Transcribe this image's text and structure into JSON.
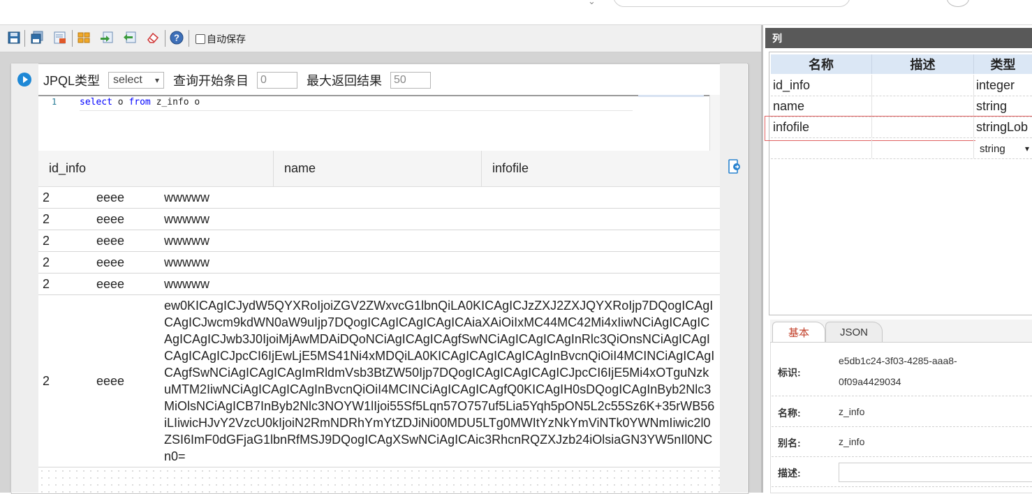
{
  "toolbar": {
    "icons": [
      "save-icon",
      "save-all-icon",
      "export-icon",
      "database-icon",
      "import-icon",
      "transfer-icon",
      "eraser-icon",
      "help-icon"
    ],
    "autosave_label": "自动保存"
  },
  "query": {
    "type_label": "JPQL类型",
    "type_value": "select",
    "start_label": "查询开始条目",
    "start_value": "0",
    "max_label": "最大返回结果",
    "max_value": "50",
    "line_number": "1",
    "code_kw1": "select",
    "code_mid": " o ",
    "code_kw2": "from",
    "code_rest": " z_info o"
  },
  "results": {
    "columns": [
      "id_info",
      "name",
      "infofile"
    ],
    "rows": [
      {
        "id": "2",
        "name": "eeee",
        "file": "wwwww"
      },
      {
        "id": "2",
        "name": "eeee",
        "file": "wwwww"
      },
      {
        "id": "2",
        "name": "eeee",
        "file": "wwwww"
      },
      {
        "id": "2",
        "name": "eeee",
        "file": "wwwww"
      },
      {
        "id": "2",
        "name": "eeee",
        "file": "wwwww"
      },
      {
        "id": "2",
        "name": "eeee",
        "file": "ew0KICAgICJydW5QYXRoIjoiZGV2ZWxvcG1lbnQiLA0KICAgICJzZXJ2ZXJQYXRoIjp7DQogICAgICAgICJwcm9kdWN0aW9uIjp7DQogICAgICAgICAgICAiaXAiOiIxMC44MC42Mi4xIiwNCiAgICAgICAgICAgICJwb3J0IjoiMjAwMDAiDQoNCiAgICAgICAgfSwNCiAgICAgICAgInRlc3QiOnsNCiAgICAgICAgICAgICJpcCI6IjEwLjE5MS41Ni4xMDQiLA0KICAgICAgICAgICAgInBvcnQiOiI4MCINCiAgICAgICAgfSwNCiAgICAgICAgImRldmVsb3BtZW50Ijp7DQogICAgICAgICAgICJpcCI6IjE5Mi4xOTguNzkuMTM2IiwNCiAgICAgICAgInBvcnQiOiI4MCINCiAgICAgICAgfQ0KICAgIH0sDQogICAgInByb2Nlc3MiOlsNCiAgICB7InByb2Nlc3NOYW1lIjoi55Sf5Lqn57O757uf5Lia5Yqh5pON5L2c55Sz6K+35rWB56iLIiwicHJvY2VzcU0kIjoiN2RmNDRhYmYtZDJiNi00MDU5LTg0MWItYzNkYmViNTk0YWNmIiwic2l0ZSI6ImF0dGFjaG1lbnRfMSJ9DQogICAgXSwNCiAgICAic3RhcnRQZXJzb24iOlsiaGN3YW5nIl0NCn0="
      }
    ]
  },
  "columns_panel": {
    "title": "列",
    "headers": [
      "名称",
      "描述",
      "类型"
    ],
    "rows": [
      {
        "name": "id_info",
        "desc": "",
        "type": "integer"
      },
      {
        "name": "name",
        "desc": "",
        "type": "string"
      },
      {
        "name": "infofile",
        "desc": "",
        "type": "stringLob"
      }
    ],
    "new_row_type": "string"
  },
  "tabs": [
    "基本",
    "JSON"
  ],
  "properties": {
    "id_label": "标识:",
    "id_value_line1": "e5db1c24-3f03-4285-aaa8-",
    "id_value_line2": "0f09a4429034",
    "name_label": "名称:",
    "name_value": "z_info",
    "alias_label": "别名:",
    "alias_value": "z_info",
    "desc_label": "描述:",
    "desc_value": ""
  },
  "colors": {
    "accent": "#1e88d6",
    "titlebar": "#595959",
    "grid_header": "#dbe7f5",
    "active_tab_text": "#c2402a",
    "selection_border": "#e06060"
  }
}
